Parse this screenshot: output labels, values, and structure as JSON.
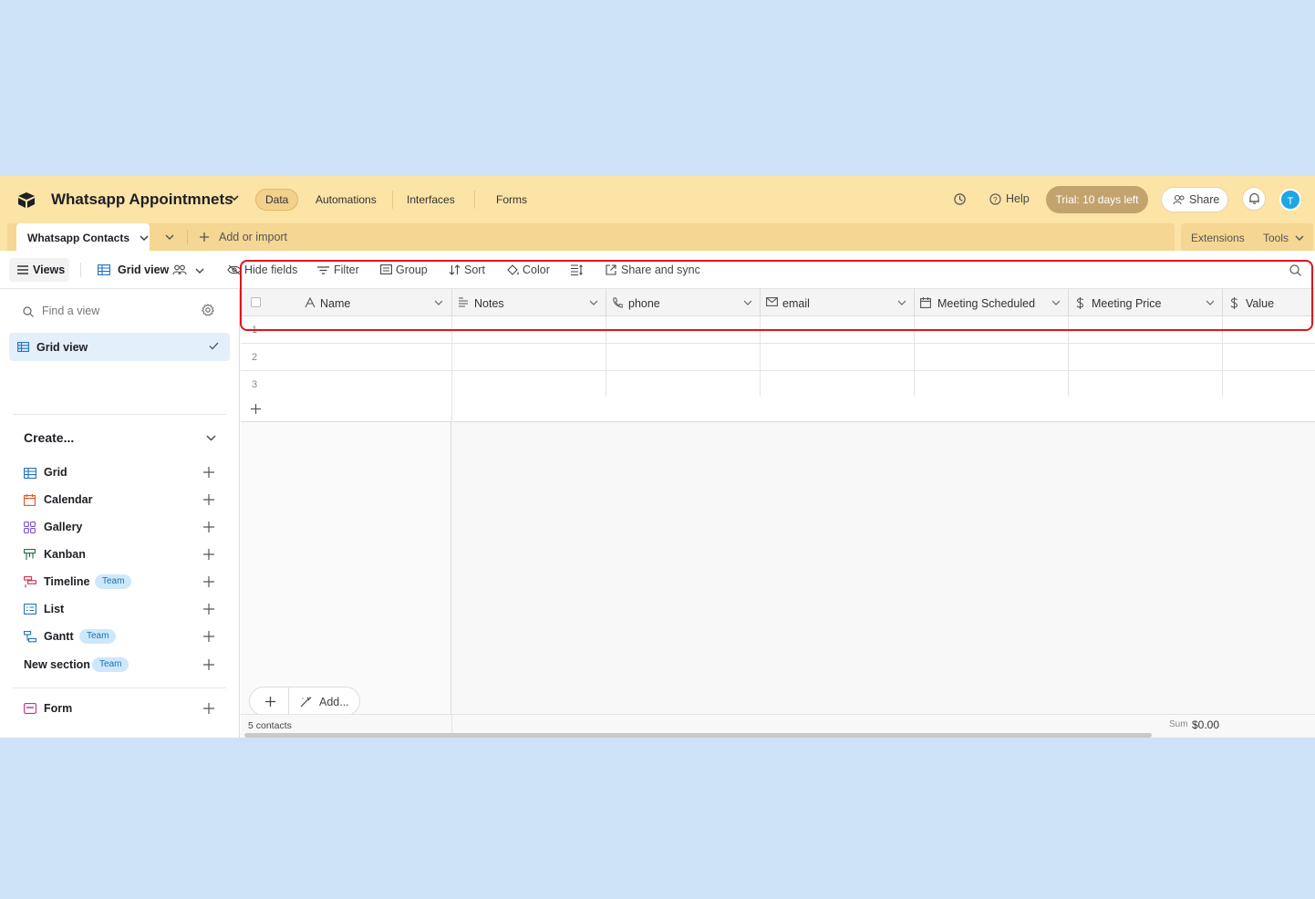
{
  "header": {
    "base_name": "Whatsapp Appointmnets",
    "nav_tabs": [
      "Data",
      "Automations",
      "Interfaces",
      "Forms"
    ],
    "help": "Help",
    "trial": "Trial: 10 days left",
    "share": "Share",
    "avatar_initial": "T"
  },
  "tabs_bar": {
    "table_tab": "Whatsapp Contacts",
    "add_import": "Add or import",
    "extensions": "Extensions",
    "tools": "Tools"
  },
  "toolbar": {
    "views": "Views",
    "view_name": "Grid view",
    "hide_fields": "Hide fields",
    "filter": "Filter",
    "group": "Group",
    "sort": "Sort",
    "color": "Color",
    "share_sync": "Share and sync"
  },
  "sidebar": {
    "find_placeholder": "Find a view",
    "active_view": "Grid view",
    "create_title": "Create...",
    "create_items": [
      {
        "label": "Grid",
        "icon": "grid-icon"
      },
      {
        "label": "Calendar",
        "icon": "calendar-icon"
      },
      {
        "label": "Gallery",
        "icon": "gallery-icon"
      },
      {
        "label": "Kanban",
        "icon": "kanban-icon"
      },
      {
        "label": "Timeline",
        "icon": "timeline-icon",
        "badge": "Team"
      },
      {
        "label": "List",
        "icon": "list-icon"
      },
      {
        "label": "Gantt",
        "icon": "gantt-icon",
        "badge": "Team"
      },
      {
        "label": "New section",
        "badge": "Team"
      },
      {
        "label": "Form",
        "icon": "form-icon"
      }
    ]
  },
  "grid": {
    "columns": [
      {
        "name": "Name",
        "icon": "text-icon"
      },
      {
        "name": "Notes",
        "icon": "long-text-icon"
      },
      {
        "name": "phone",
        "icon": "phone-icon"
      },
      {
        "name": "email",
        "icon": "email-icon"
      },
      {
        "name": "Meeting Scheduled",
        "icon": "calendar-icon"
      },
      {
        "name": "Meeting Price",
        "icon": "currency-icon"
      },
      {
        "name": "Value",
        "icon": "currency-icon"
      }
    ],
    "row_numbers": [
      "1",
      "2",
      "3"
    ],
    "add_label": "Add...",
    "record_count": "5 contacts",
    "sum_label": "Sum",
    "sum_value": "$0.00"
  },
  "colors": {
    "header_bg": "#fce3a6",
    "accent": "#1ea7e4",
    "highlight": "#e0141c"
  }
}
